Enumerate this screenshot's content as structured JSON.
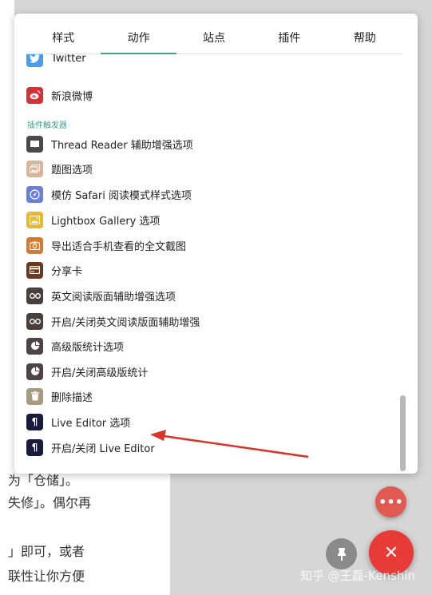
{
  "tabs": [
    {
      "label": "样式",
      "active": false
    },
    {
      "label": "动作",
      "active": true
    },
    {
      "label": "站点",
      "active": false
    },
    {
      "label": "插件",
      "active": false
    },
    {
      "label": "帮助",
      "active": false
    }
  ],
  "items_top": [
    {
      "label": "Twitter",
      "icon": "twitter-icon",
      "color": "#4a9de8"
    },
    {
      "label": "新浪微博",
      "icon": "weibo-icon",
      "color": "#d8303a"
    }
  ],
  "section_label": "插件触发器",
  "items": [
    {
      "label": "Thread Reader 辅助增强选项",
      "icon": "book-icon",
      "color": "#4a4a4a"
    },
    {
      "label": "题图选项",
      "icon": "images-icon",
      "color": "#d9b39a"
    },
    {
      "label": "模仿 Safari 阅读模式样式选项",
      "icon": "compass-icon",
      "color": "#6a7fd8"
    },
    {
      "label": "Lightbox Gallery 选项",
      "icon": "gallery-icon",
      "color": "#e8b92e"
    },
    {
      "label": "导出适合手机查看的全文截图",
      "icon": "camera-icon",
      "color": "#d47a32"
    },
    {
      "label": "分享卡",
      "icon": "card-icon",
      "color": "#6b3a22"
    },
    {
      "label": "英文阅读版面辅助增强选项",
      "icon": "glasses-icon",
      "color": "#4a3f3f"
    },
    {
      "label": "开启/关闭英文阅读版面辅助增强",
      "icon": "glasses-icon",
      "color": "#4a3f3f"
    },
    {
      "label": "高级版统计选项",
      "icon": "pie-chart-icon",
      "color": "#4e4448"
    },
    {
      "label": "开启/关闭高级版统计",
      "icon": "pie-chart-icon",
      "color": "#4e4448"
    },
    {
      "label": "删除描述",
      "icon": "trash-icon",
      "color": "#a69a80"
    },
    {
      "label": "Live Editor 选项",
      "icon": "paragraph-icon",
      "color": "#1c1a3a"
    },
    {
      "label": "开启/关闭 Live Editor",
      "icon": "paragraph-icon",
      "color": "#1c1a3a"
    }
  ],
  "background_text": [
    "为「仓储」。",
    "失修」。偶尔再",
    "」即可，或者",
    "联性让你方便"
  ],
  "fab": {
    "more": "•••",
    "close": "✕"
  },
  "watermark": "知乎 @王磊-Kenshin",
  "colors": {
    "accent": "#4a9e8e",
    "fab_red": "#e83a36",
    "arrow_red": "#d8352a"
  }
}
